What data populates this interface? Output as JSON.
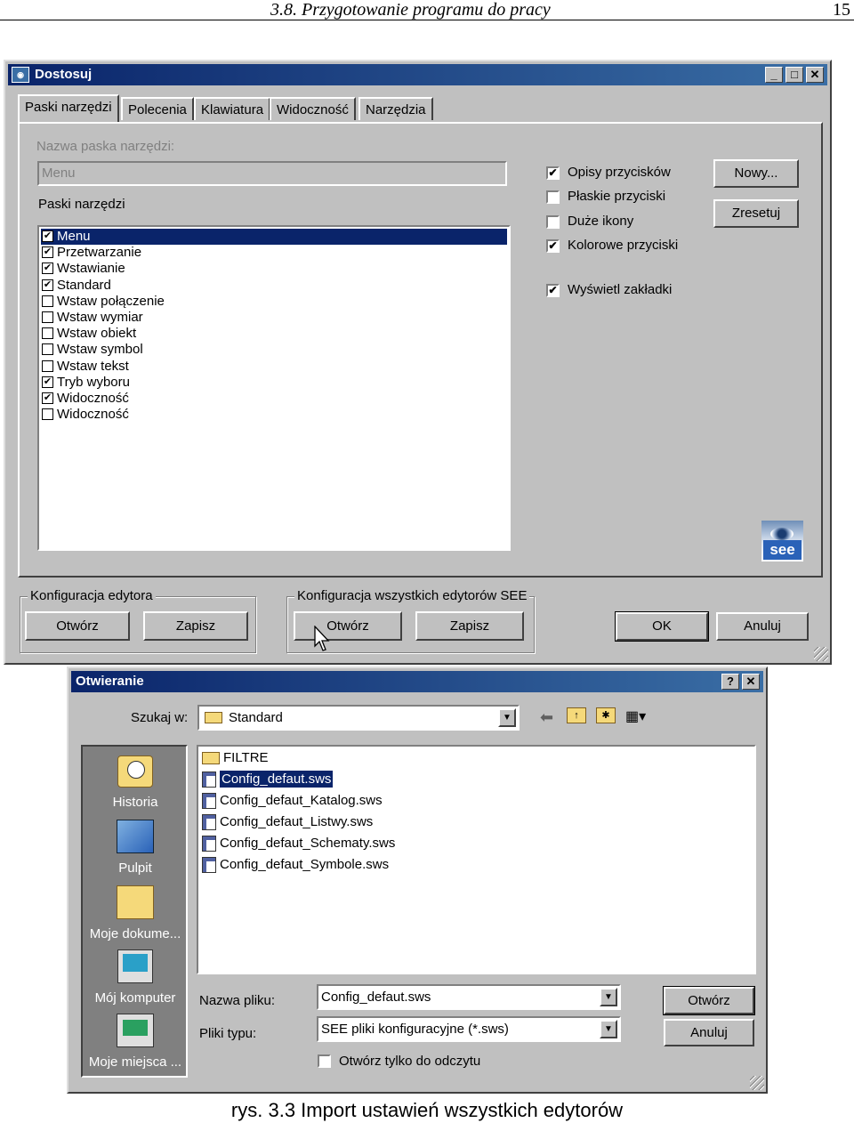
{
  "page": {
    "header_title": "3.8. Przygotowanie programu do pracy",
    "page_number": "15",
    "caption": "rys. 3.3 Import ustawień wszystkich edytorów"
  },
  "dostosuj": {
    "title": "Dostosuj",
    "logo_text": "see",
    "tabs": [
      "Paski narzędzi",
      "Polecenia",
      "Klawiatura",
      "Widoczność",
      "Narzędzia"
    ],
    "toolbar_name_label": "Nazwa paska narzędzi:",
    "toolbar_name_value": "Menu",
    "toolbars_label": "Paski narzędzi",
    "toolbars": [
      {
        "label": "Menu",
        "checked": true
      },
      {
        "label": "Przetwarzanie",
        "checked": true
      },
      {
        "label": "Wstawianie",
        "checked": true
      },
      {
        "label": "Standard",
        "checked": true
      },
      {
        "label": "Wstaw połączenie",
        "checked": false
      },
      {
        "label": "Wstaw wymiar",
        "checked": false
      },
      {
        "label": "Wstaw obiekt",
        "checked": false
      },
      {
        "label": "Wstaw symbol",
        "checked": false
      },
      {
        "label": "Wstaw tekst",
        "checked": false
      },
      {
        "label": "Tryb wyboru",
        "checked": true
      },
      {
        "label": "Widoczność",
        "checked": true
      },
      {
        "label": "Widoczność",
        "checked": false
      }
    ],
    "options": [
      {
        "label": "Opisy przycisków",
        "checked": true
      },
      {
        "label": "Płaskie przyciski",
        "checked": false
      },
      {
        "label": "Duże ikony",
        "checked": false
      },
      {
        "label": "Kolorowe przyciski",
        "checked": true
      },
      {
        "label": "Wyświetl zakładki",
        "checked": true
      }
    ],
    "new_button": "Nowy...",
    "reset_button": "Zresetuj",
    "group_editor": "Konfiguracja edytora",
    "group_all": "Konfiguracja wszystkich edytorów SEE",
    "open_label": "Otwórz",
    "save_label": "Zapisz",
    "ok_label": "OK",
    "cancel_label": "Anuluj"
  },
  "otwieranie": {
    "title": "Otwieranie",
    "help_btn": "?",
    "look_in_label": "Szukaj w:",
    "look_in_value": "Standard",
    "places": [
      "Historia",
      "Pulpit",
      "Moje dokume...",
      "Mój komputer",
      "Moje miejsca ..."
    ],
    "files": [
      "FILTRE",
      "Config_defaut.sws",
      "Config_defaut_Katalog.sws",
      "Config_defaut_Listwy.sws",
      "Config_defaut_Schematy.sws",
      "Config_defaut_Symbole.sws"
    ],
    "selected_file_index": 1,
    "filename_label": "Nazwa pliku:",
    "filename_value": "Config_defaut.sws",
    "filetype_label": "Pliki typu:",
    "filetype_value": "SEE pliki konfiguracyjne (*.sws)",
    "readonly_label": "Otwórz tylko do odczytu",
    "open_button": "Otwórz",
    "cancel_button": "Anuluj"
  }
}
